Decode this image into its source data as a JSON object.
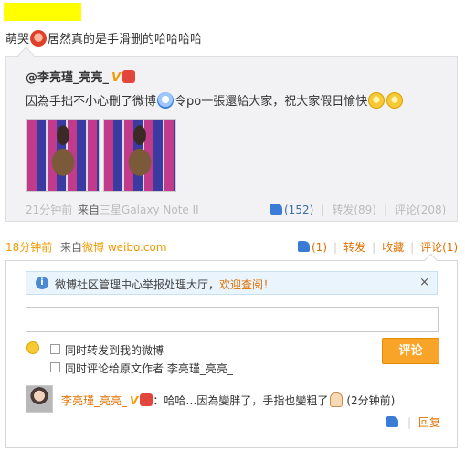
{
  "post": {
    "text_before": "萌哭",
    "text_after": "居然真的是手滑删的哈哈哈哈",
    "emoji": "crying-red-emoji",
    "time": "18分钟前",
    "from_prefix": "来自",
    "from_source": "微博 weibo.com",
    "like_count": "(1)",
    "forward": "转发",
    "favorite": "收藏",
    "comment": "评论(1)"
  },
  "quote": {
    "author": "@李亮瑾_亮亮_",
    "text_before": "因為手拙不小心刪了微博",
    "text_middle": "令po一張還給大家，祝大家假日愉快",
    "time": "21分钟前",
    "from_prefix": "来自",
    "from_source": "三星Galaxy Note II",
    "like_count": "(152)",
    "forward": "转发(89)",
    "comment": "评论(208)"
  },
  "comment_box": {
    "notice": "微博社区管理中心举报处理大厅，",
    "notice_link": "欢迎查阅！",
    "close": "×",
    "input_value": "",
    "forward_option": "同时转发到我的微博",
    "original_option": "同时评论给原文作者 李亮瑾_亮亮_",
    "submit": "评论"
  },
  "comment": {
    "user": "李亮瑾_亮亮_",
    "text": "：哈哈…因為變胖了，手指也變粗了",
    "time": "(2分钟前)",
    "reply": "回复"
  },
  "colors": {
    "accent": "#e07000",
    "link_blue": "#3a6ea5",
    "highlight": "#ffff00",
    "submit_bg": "#f7a428"
  }
}
